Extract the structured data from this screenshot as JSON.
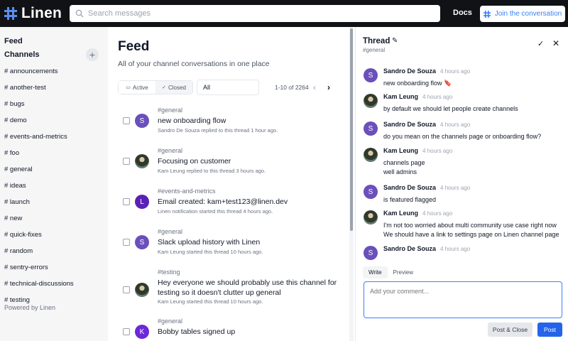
{
  "header": {
    "logo_text": "Linen",
    "search_placeholder": "Search messages",
    "docs_label": "Docs",
    "join_label": "Join the conversation",
    "logo_color": "#5b8def"
  },
  "sidebar": {
    "feed_label": "Feed",
    "channels_label": "Channels",
    "add_label": "+",
    "items": [
      {
        "label": "# announcements"
      },
      {
        "label": "# another-test"
      },
      {
        "label": "# bugs"
      },
      {
        "label": "# demo"
      },
      {
        "label": "# events-and-metrics"
      },
      {
        "label": "# foo"
      },
      {
        "label": "# general"
      },
      {
        "label": "# ideas"
      },
      {
        "label": "# launch"
      },
      {
        "label": "# new"
      },
      {
        "label": "# quick-fixes"
      },
      {
        "label": "# random"
      },
      {
        "label": "# sentry-errors"
      },
      {
        "label": "# technical-discussions"
      },
      {
        "label": "# testing"
      }
    ],
    "powered_by": "Powered by Linen"
  },
  "feed": {
    "title": "Feed",
    "subtitle": "All of your channel conversations in one place",
    "tab_active": "Active",
    "tab_closed": "Closed",
    "filter_value": "All",
    "pagination": "1-10 of 2264",
    "rows": [
      {
        "channel": "#general",
        "title": "new onboarding flow",
        "meta": "Sandro De Souza replied to this thread 1 hour ago.",
        "avatar": "S",
        "avatar_color": "#6b4fbb",
        "photo": false
      },
      {
        "channel": "#general",
        "title": "Focusing on customer",
        "meta": "Kam Leung replied to this thread 3 hours ago.",
        "avatar": "",
        "avatar_color": "#3f4a3a",
        "photo": true
      },
      {
        "channel": "#events-and-metrics",
        "title": "Email created: kam+test123@linen.dev",
        "meta": "Linen notification started this thread 4 hours ago.",
        "avatar": "L",
        "avatar_color": "#5b21b6",
        "photo": false
      },
      {
        "channel": "#general",
        "title": "Slack upload history with Linen",
        "meta": "Kam Leung started this thread 10 hours ago.",
        "avatar": "S",
        "avatar_color": "#6b4fbb",
        "photo": false
      },
      {
        "channel": "#testing",
        "title": "Hey everyone we should probably use this channel for testing so it doesn't clutter up general",
        "meta": "Kam Leung started this thread 10 hours ago.",
        "avatar": "",
        "avatar_color": "#3f4a3a",
        "photo": true
      },
      {
        "channel": "#general",
        "title": "Bobby tables signed up",
        "meta": "",
        "avatar": "K",
        "avatar_color": "#6d28d9",
        "photo": false
      }
    ]
  },
  "thread": {
    "title": "Thread",
    "channel": "#general",
    "messages": [
      {
        "name": "Sandro De Souza",
        "time": "4 hours ago",
        "lines": [
          "new onboarding flow 🔖"
        ],
        "avatar": "S",
        "photo": false
      },
      {
        "name": "Kam Leung",
        "time": "4 hours ago",
        "lines": [
          "by default we should let people create channels"
        ],
        "avatar": "",
        "photo": true
      },
      {
        "name": "Sandro De Souza",
        "time": "4 hours ago",
        "lines": [
          "do you mean on the channels page or onboarding flow?"
        ],
        "avatar": "S",
        "photo": false
      },
      {
        "name": "Kam Leung",
        "time": "4 hours ago",
        "lines": [
          "channels page",
          "well admins"
        ],
        "avatar": "",
        "photo": true
      },
      {
        "name": "Sandro De Souza",
        "time": "4 hours ago",
        "lines": [
          "is featured flagged"
        ],
        "avatar": "S",
        "photo": false
      },
      {
        "name": "Kam Leung",
        "time": "4 hours ago",
        "lines": [
          "I'm not too worried about multi community use case right now",
          "We should have a link to settings page on Linen channel page"
        ],
        "avatar": "",
        "photo": true
      },
      {
        "name": "Sandro De Souza",
        "time": "4 hours ago",
        "lines": [
          ""
        ],
        "avatar": "S",
        "photo": false
      }
    ],
    "tab_write": "Write",
    "tab_preview": "Preview",
    "comment_placeholder": "Add your comment...",
    "post_close_label": "Post & Close",
    "post_label": "Post"
  }
}
